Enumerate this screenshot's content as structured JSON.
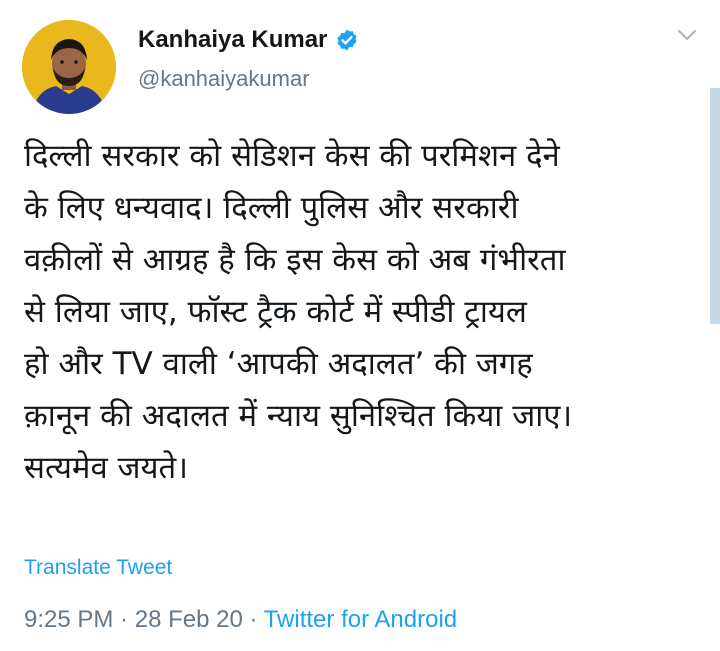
{
  "author": {
    "display_name": "Kanhaiya Kumar",
    "handle": "@kanhaiyakumar",
    "verified": true
  },
  "tweet": {
    "text": "दिल्ली सरकार को सेडिशन केस की परमिशन देने\nके लिए धन्यवाद। दिल्ली पुलिस और सरकारी\nवक़ीलों से आग्रह है कि इस केस को अब गंभीरता\nसे लिया जाए, फॉस्ट ट्रैक कोर्ट में स्पीडी ट्रायल\nहो और TV वाली ‘आपकी अदालत’ की जगह\nक़ानून की अदालत में न्याय सुनिश्चित किया जाए।\nसत्यमेव जयते।"
  },
  "actions": {
    "translate_label": "Translate Tweet"
  },
  "meta": {
    "time": "9:25 PM",
    "separator": " · ",
    "date": "28 Feb 20",
    "source": "Twitter for Android"
  },
  "icons": {
    "verified": "verified-badge-icon",
    "more": "chevron-down-icon"
  },
  "colors": {
    "link": "#1da1f2",
    "secondary": "#657786",
    "text": "#14171a",
    "verified": "#1da1f2",
    "avatar_bg": "#e9b81c"
  }
}
